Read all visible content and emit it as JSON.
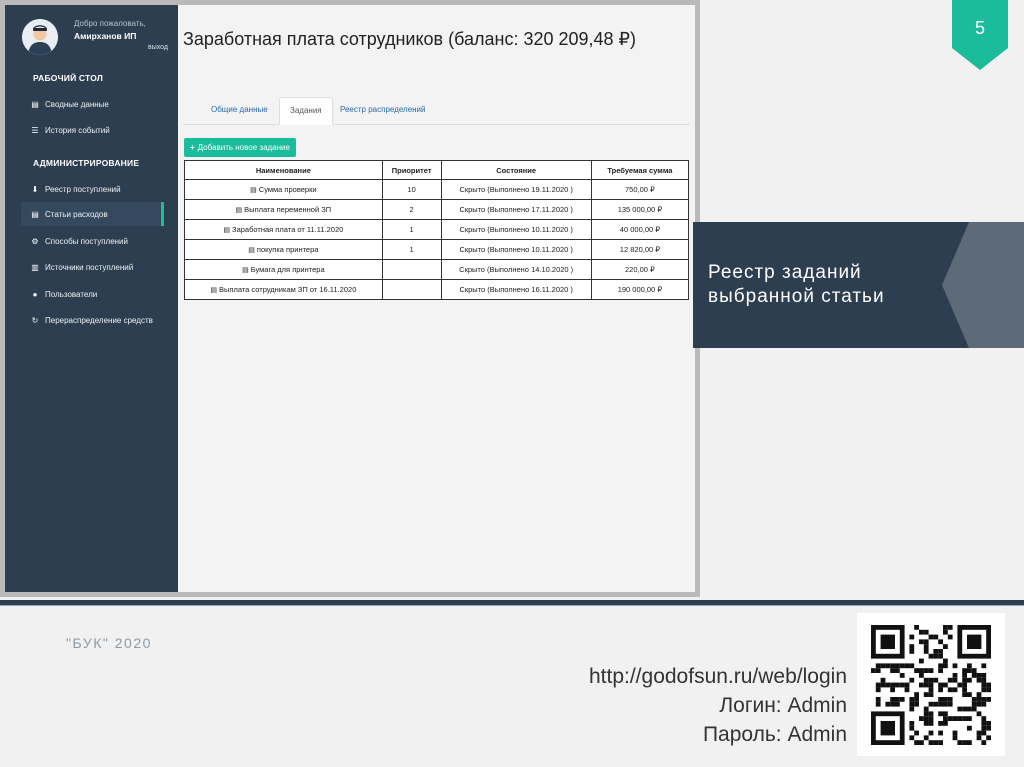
{
  "sidebar": {
    "welcome": "Добро пожаловать,",
    "username": "Амирханов ИП",
    "logout": "выход",
    "sections": [
      {
        "title": "РАБОЧИЙ СТОЛ",
        "items": [
          {
            "label": "Сводные данные",
            "icon": "server-icon"
          },
          {
            "label": "История событий",
            "icon": "list-icon"
          }
        ]
      },
      {
        "title": "АДМИНИСТРИРОВАНИЕ",
        "items": [
          {
            "label": "Реестр поступлений",
            "icon": "download-icon"
          },
          {
            "label": "Статьи расходов",
            "icon": "server-icon"
          },
          {
            "label": "Способы поступлений",
            "icon": "gear-icon"
          },
          {
            "label": "Источники поступлений",
            "icon": "bar-chart-icon"
          },
          {
            "label": "Пользователи",
            "icon": "user-icon"
          },
          {
            "label": "Перераспределение средств",
            "icon": "refresh-icon"
          }
        ]
      }
    ]
  },
  "main": {
    "title": "Заработная плата сотрудников (баланс: 320 209,48 ₽)",
    "tabs": [
      "Общие данные",
      "Задания",
      "Реестр распределений"
    ],
    "active_tab": "Задания",
    "add_button": "Добавить новое задание",
    "table": {
      "headers": [
        "Наименование",
        "Приоритет",
        "Состояние",
        "Требуемая сумма"
      ],
      "rows": [
        {
          "name": "Сумма проверки",
          "priority": "10",
          "status": "Скрыто (Выполнено 19.11.2020 )",
          "amount": "750,00 ₽"
        },
        {
          "name": "Выплата переменной ЗП",
          "priority": "2",
          "status": "Скрыто (Выполнено 17.11.2020 )",
          "amount": "135 000,00 ₽"
        },
        {
          "name": "Заработная плата от 11.11.2020",
          "priority": "1",
          "status": "Скрыто (Выполнено 10.11.2020 )",
          "amount": "40 000,00 ₽"
        },
        {
          "name": "покупка принтера",
          "priority": "1",
          "status": "Скрыто (Выполнено 10.11.2020 )",
          "amount": "12 820,00 ₽"
        },
        {
          "name": "Бумага для принтера",
          "priority": "",
          "status": "Скрыто (Выполнено 14.10.2020 )",
          "amount": "220,00 ₽"
        },
        {
          "name": "Выплата сотрудникам ЗП от 16.11.2020",
          "priority": "",
          "status": "Скрыто (Выполнено 16.11.2020 )",
          "amount": "190 000,00 ₽"
        }
      ]
    }
  },
  "slide": {
    "number": "5",
    "banner_line1": "Реестр заданий",
    "banner_line2": "выбранной статьи",
    "footer_year": "\"БУК\" 2020",
    "url": "http://godofsun.ru/web/login",
    "login": "Логин: Admin",
    "password": "Пароль: Admin"
  },
  "colors": {
    "sidebar_bg": "#2c3e50",
    "accent": "#1abc9c",
    "badge": "#1abc9c",
    "banner_dark": "#2c3e50",
    "banner_light": "#5d6b78"
  }
}
